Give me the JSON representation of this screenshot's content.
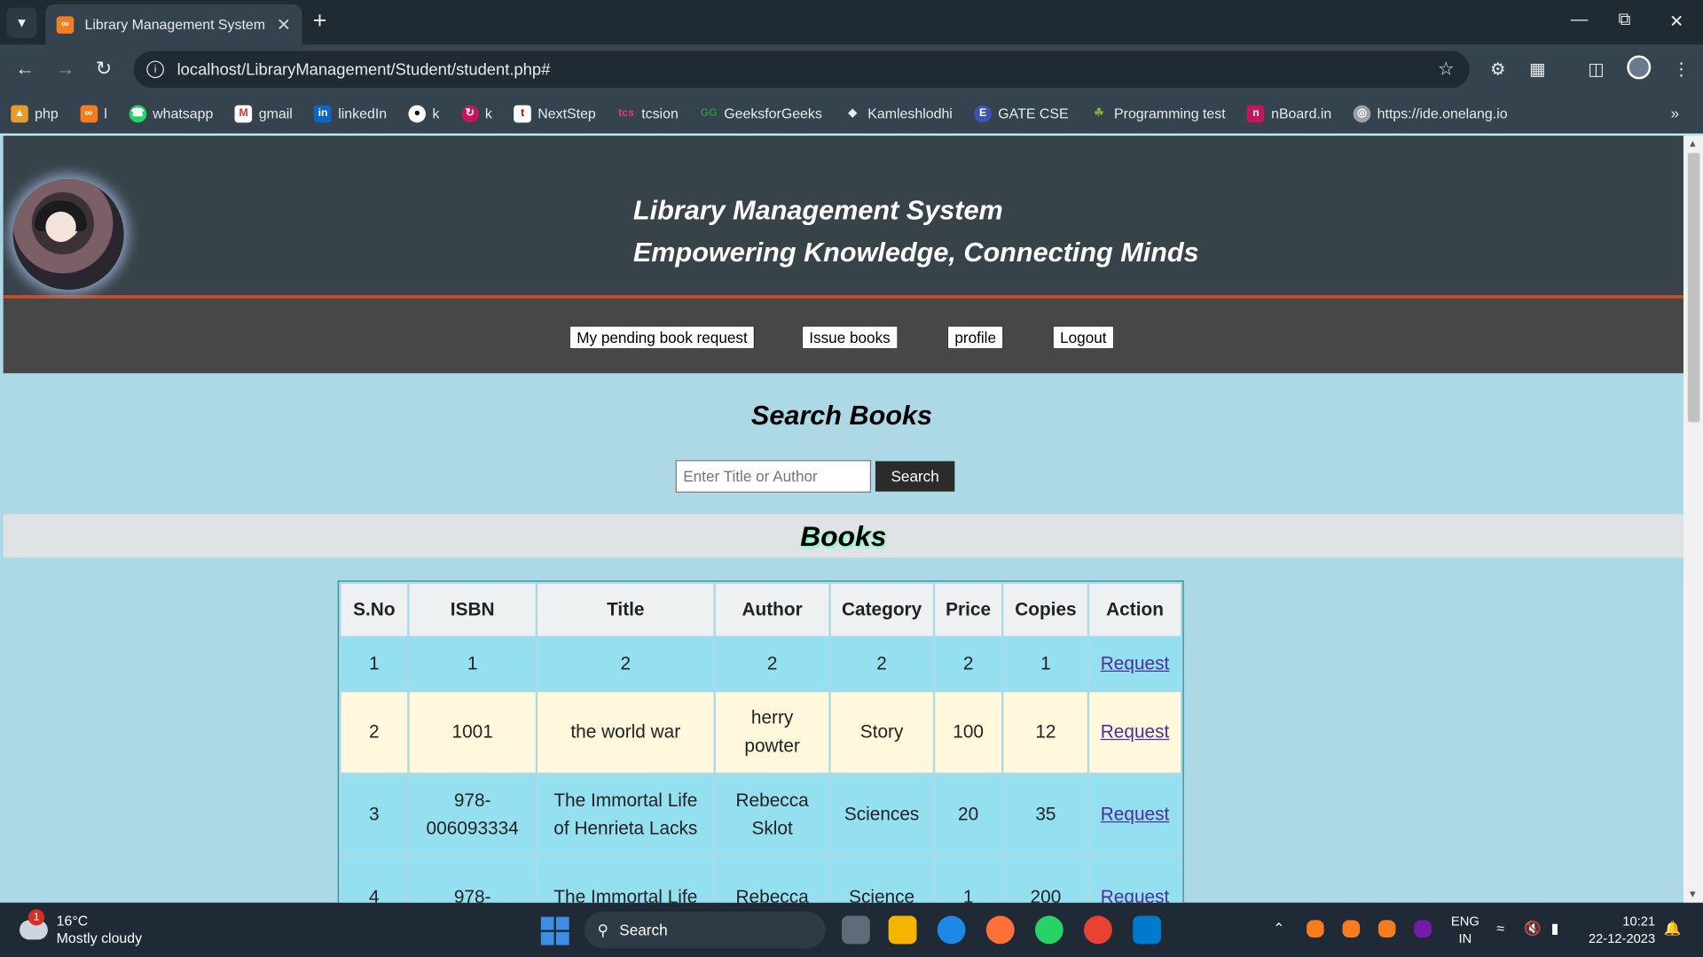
{
  "browser": {
    "tab_title": "Library Management System",
    "url": "localhost/LibraryManagement/Student/student.php#",
    "bookmarks": [
      "php",
      "l",
      "whatsapp",
      "gmail",
      "linkedIn",
      "k",
      "k",
      "NextStep",
      "tcsion",
      "GeeksforGeeks",
      "Kamleshlodhi",
      "GATE CSE",
      "Programming test",
      "nBoard.in",
      "https://ide.onelang.io"
    ]
  },
  "header": {
    "title": "Library Management System",
    "subtitle": "Empowering Knowledge, Connecting Minds"
  },
  "nav": {
    "pending": "My pending book request",
    "issue": "Issue books",
    "profile": "profile",
    "logout": "Logout"
  },
  "search": {
    "heading": "Search Books",
    "placeholder": "Enter Title or Author",
    "button": "Search"
  },
  "books": {
    "heading": "Books",
    "columns": [
      "S.No",
      "ISBN",
      "Title",
      "Author",
      "Category",
      "Price",
      "Copies",
      "Action"
    ],
    "rows": [
      [
        "1",
        "1",
        "2",
        "2",
        "2",
        "2",
        "1",
        "Request"
      ],
      [
        "2",
        "1001",
        "the world war",
        "herry powter",
        "Story",
        "100",
        "12",
        "Request"
      ],
      [
        "3",
        "978-006093334",
        "The Immortal Life of Henrieta Lacks",
        "Rebecca Sklot",
        "Sciences",
        "20",
        "35",
        "Request"
      ],
      [
        "4",
        "978-",
        "The Immortal Life",
        "Rebecca",
        "Science",
        "1",
        "200",
        "Request"
      ]
    ]
  },
  "taskbar": {
    "temperature": "16°C",
    "weather": "Mostly cloudy",
    "weather_badge": "1",
    "search": "Search",
    "lang_top": "ENG",
    "lang_bottom": "IN",
    "time": "10:21",
    "date": "22-12-2023"
  }
}
